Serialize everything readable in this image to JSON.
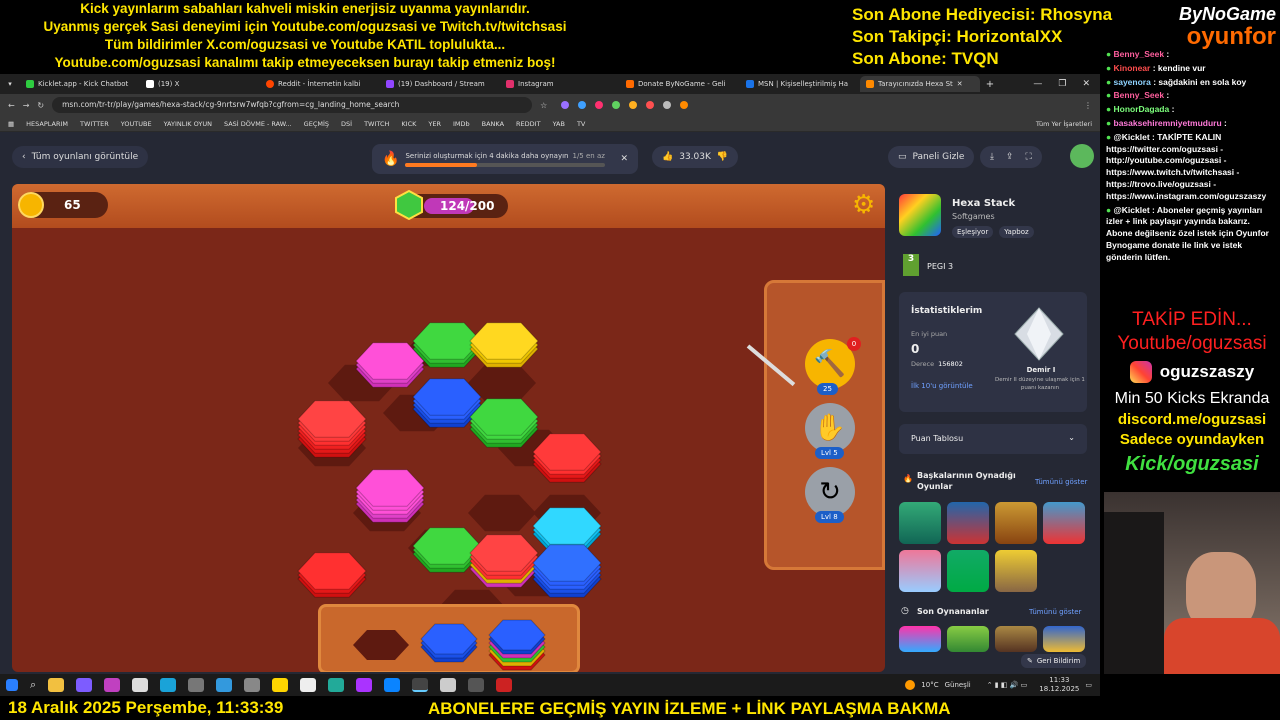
{
  "overlay": {
    "ticker_lines": [
      "Kick yayınlarım sabahları kahveli miskin enerjisiz uyanma yayınlarıdır.",
      "Uyanmış gerçek Sasi deneyimi için Youtube.com/oguzsasi ve Twitch.tv/twitchsasi",
      "Tüm bildirimler X.com/oguzsasi ve Youtube KATIL toplulukta...",
      "Youtube.com/oguzsasi kanalımı takip etmeyeceksen burayı takip etmeniz boş!"
    ],
    "sub_info": [
      "Son Abone Hediyecisi: Rhosyna",
      "Son Takipçi: HorizontalXX",
      "Son Abone: TVQN"
    ],
    "brand_top": "ByNoGame",
    "brand_bottom": "oyunfor",
    "date_text": "18 Aralık 2025 Perşembe, 11:33:39",
    "bottom_banner": "ABONELERE GEÇMİŞ YAYIN İZLEME + LİNK PAYLAŞMA BAKMA",
    "colors": {
      "ticker": "#ffe600",
      "subinfo": "#ffe600",
      "date": "#ffe600",
      "brand_orange": "#ff6a00"
    }
  },
  "browser": {
    "tabs": [
      {
        "label": "Kicklet.app - Kick Chatbot",
        "color": "#2ecc40"
      },
      {
        "label": "(19) X",
        "color": "#ffffff"
      },
      {
        "label": "Reddit - İnternetin kalbi",
        "color": "#ff4500"
      },
      {
        "label": "(19) Dashboard / Stream",
        "color": "#9146ff"
      },
      {
        "label": "Instagram",
        "color": "#e1306c"
      },
      {
        "label": "Donate ByNoGame - Geli",
        "color": "#ff6a00"
      },
      {
        "label": "MSN | Kişiselleştirilmiş Ha",
        "color": "#1a73e8"
      },
      {
        "label": "Tarayıcınızda Hexa St",
        "color": "#ff8a00"
      }
    ],
    "url": "msn.com/tr-tr/play/games/hexa-stack/cg-9nrtsrw7wfqb?cgfrom=cg_landing_home_search",
    "bookmarks": [
      "HESAPLARIM",
      "TWITTER",
      "YOUTUBE",
      "YAYINLIK OYUN",
      "SASİ DÖVME - RAW...",
      "GEÇMİŞ",
      "DSİ",
      "TWITCH",
      "KICK",
      "YER",
      "IMDb",
      "BANKA",
      "REDDIT",
      "YAB",
      "TV",
      "Tüm Yer İşaretleri"
    ]
  },
  "page": {
    "back_label": "Tüm oyunlanı görüntüle",
    "notice_text": "Serinizi oluşturmak için 4 dakika daha oynayın",
    "notice_progress": "1/5 en az",
    "likes": "33.03K",
    "panel_toggle": "Paneli Gizle"
  },
  "game": {
    "coins": "65",
    "progress_label": "124/200",
    "progress_fraction": 0.62,
    "tools": [
      {
        "name": "hammer",
        "badge": "25",
        "count": "0"
      },
      {
        "name": "hand",
        "badge": "Lvl 5"
      },
      {
        "name": "shuffle",
        "badge": "Lvl 8"
      }
    ]
  },
  "side_panel": {
    "game_title": "Hexa Stack",
    "publisher": "Softgames",
    "tags": [
      "Eşleşiyor",
      "Yapboz"
    ],
    "pegi": "PEGI 3",
    "stats_title": "İstatistiklerim",
    "best_label": "En iyi puan",
    "best_value": "0",
    "rank_label": "Derece",
    "rank_value": "156802",
    "top10_label": "İlk 10'u görüntüle",
    "tier_name": "Demir I",
    "tier_desc": "Demir II düzeyine ulaşmak için 1 puanı kazanın",
    "leaderboard": "Puan Tablosu",
    "others_title": "Başkalarının Oynadığı Oyunlar",
    "show_all": "Tümünü göster",
    "recent_title": "Son Oynananlar",
    "show_all_2": "Tümünü göster",
    "report": "Geri Bildirim"
  },
  "chat": {
    "messages": [
      {
        "user": "Benny_Seek",
        "text": ":",
        "color": "#ff5f9e"
      },
      {
        "user": "Kinonear",
        "text": ": kendine vur",
        "color": "#ff4d4d"
      },
      {
        "user": "sayenora",
        "text": ": sağdakini en sola koy",
        "color": "#8fd3ff"
      },
      {
        "user": "Benny_Seek",
        "text": ":",
        "color": "#ff5f9e"
      },
      {
        "user": "HonorDagada",
        "text": ":",
        "color": "#7cff7c"
      },
      {
        "user": "basaksehiremniyetmuduru",
        "text": ":",
        "color": "#ff7ad9"
      },
      {
        "user": "@Kicklet",
        "text": ": TAKİPTE KALIN https://twitter.com/oguzsasi - http://youtube.com/oguzsasi - https://www.twitch.tv/twitchsasi - https://trovo.live/oguzsasi - https://www.instagram.com/oguzszaszy",
        "color": "#ffffff"
      },
      {
        "user": "@Kicklet",
        "text": ": Aboneler geçmiş yayınları izler + link paylaşır yayında bakarız. Abone değilseniz özel istek için Oyunfor Bynogame donate ile link ve istek gönderin lütfen.",
        "color": "#ffffff"
      }
    ]
  },
  "promo": {
    "follow": "TAKİP EDİN...",
    "youtube": "Youtube/oguzsasi",
    "instagram": "oguzszaszy",
    "kicks": "Min 50 Kicks Ekranda",
    "discord": "discord.me/oguzsasi",
    "only_game": "Sadece oyundayken",
    "kick": "Kick/oguzsasi"
  },
  "taskbar": {
    "weather": "10°C",
    "weather_text": "Güneşli",
    "time": "11:33",
    "date": "18.12.2025"
  }
}
